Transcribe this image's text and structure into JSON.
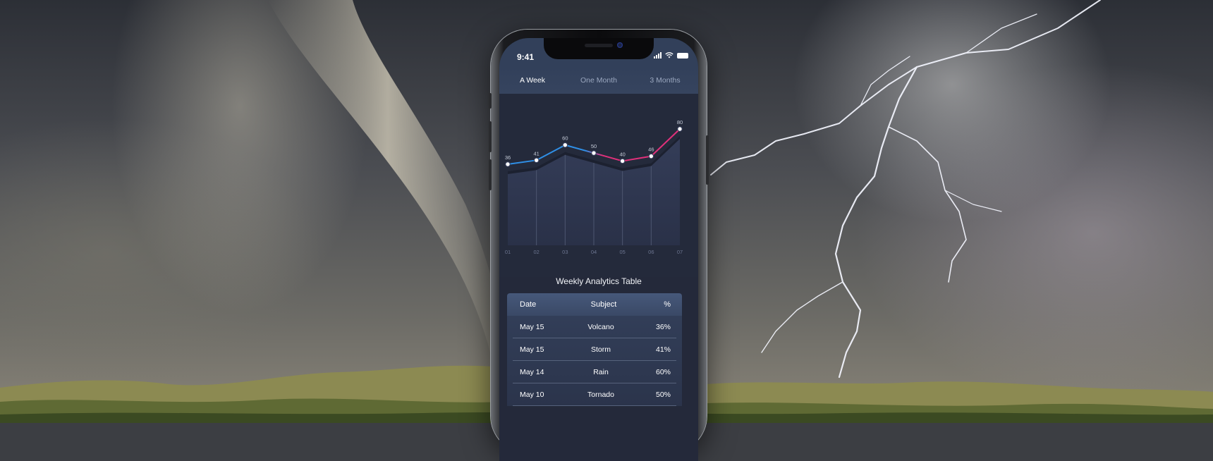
{
  "status_bar": {
    "time": "9:41"
  },
  "tabs": [
    {
      "label": "A Week",
      "active": true
    },
    {
      "label": "One Month",
      "active": false
    },
    {
      "label": "3 Months",
      "active": false
    }
  ],
  "chart_data": {
    "type": "line",
    "x": [
      "01",
      "02",
      "03",
      "04",
      "05",
      "06",
      "07"
    ],
    "values": [
      36,
      41,
      60,
      50,
      40,
      46,
      80
    ],
    "point_labels": [
      "36",
      "41",
      "60",
      "50",
      "40",
      "46",
      "80"
    ],
    "line_gradient": [
      "#2f8fe6",
      "#e0307a"
    ],
    "area_color": "#2e3650"
  },
  "table": {
    "title": "Weekly Analytics Table",
    "headers": {
      "date": "Date",
      "subject": "Subject",
      "pct": "%"
    },
    "rows": [
      {
        "date": "May 15",
        "subject": "Volcano",
        "pct": "36%"
      },
      {
        "date": "May 15",
        "subject": "Storm",
        "pct": "41%"
      },
      {
        "date": "May 14",
        "subject": "Rain",
        "pct": "60%"
      },
      {
        "date": "May 10",
        "subject": "Tornado",
        "pct": "50%"
      }
    ]
  }
}
